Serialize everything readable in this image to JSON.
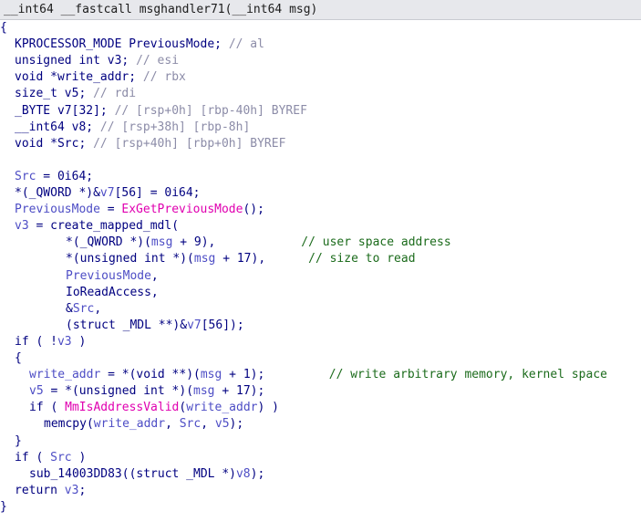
{
  "signature": "__int64 __fastcall msghandler71(__int64 msg)",
  "lines": [
    {
      "indent": 0,
      "parts": [
        {
          "t": "{",
          "k": "brace"
        }
      ]
    },
    {
      "indent": 2,
      "parts": [
        {
          "t": "KPROCESSOR_MODE PreviousMode; ",
          "k": "normal"
        },
        {
          "t": "// al",
          "k": "comment"
        }
      ]
    },
    {
      "indent": 2,
      "parts": [
        {
          "t": "unsigned int v3; ",
          "k": "normal"
        },
        {
          "t": "// esi",
          "k": "comment"
        }
      ]
    },
    {
      "indent": 2,
      "parts": [
        {
          "t": "void *write_addr; ",
          "k": "normal"
        },
        {
          "t": "// rbx",
          "k": "comment"
        }
      ]
    },
    {
      "indent": 2,
      "parts": [
        {
          "t": "size_t v5; ",
          "k": "normal"
        },
        {
          "t": "// rdi",
          "k": "comment"
        }
      ]
    },
    {
      "indent": 2,
      "parts": [
        {
          "t": "_BYTE v7[32]; ",
          "k": "normal"
        },
        {
          "t": "// [rsp+0h] [rbp-40h] BYREF",
          "k": "comment"
        }
      ]
    },
    {
      "indent": 2,
      "parts": [
        {
          "t": "__int64 v8; ",
          "k": "normal"
        },
        {
          "t": "// [rsp+38h] [rbp-8h]",
          "k": "comment"
        }
      ]
    },
    {
      "indent": 2,
      "parts": [
        {
          "t": "void *Src; ",
          "k": "normal"
        },
        {
          "t": "// [rsp+40h] [rbp+0h] BYREF",
          "k": "comment"
        }
      ]
    },
    {
      "indent": 0,
      "parts": []
    },
    {
      "indent": 2,
      "parts": [
        {
          "t": "Src",
          "k": "var"
        },
        {
          "t": " = 0i64;",
          "k": "normal"
        }
      ]
    },
    {
      "indent": 2,
      "parts": [
        {
          "t": "*(_QWORD *)&",
          "k": "normal"
        },
        {
          "t": "v7",
          "k": "var"
        },
        {
          "t": "[56] = 0i64;",
          "k": "normal"
        }
      ]
    },
    {
      "indent": 2,
      "parts": [
        {
          "t": "PreviousMode",
          "k": "var"
        },
        {
          "t": " = ",
          "k": "normal"
        },
        {
          "t": "ExGetPreviousMode",
          "k": "api"
        },
        {
          "t": "();",
          "k": "normal"
        }
      ]
    },
    {
      "indent": 2,
      "parts": [
        {
          "t": "v3",
          "k": "var"
        },
        {
          "t": " = create_mapped_mdl(",
          "k": "normal"
        }
      ]
    },
    {
      "indent": 9,
      "parts": [
        {
          "t": "*(_QWORD *)(",
          "k": "normal"
        },
        {
          "t": "msg",
          "k": "var"
        },
        {
          "t": " + 9),            ",
          "k": "normal"
        },
        {
          "t": "// user space address",
          "k": "commentcode"
        }
      ]
    },
    {
      "indent": 9,
      "parts": [
        {
          "t": "*(unsigned int *)(",
          "k": "normal"
        },
        {
          "t": "msg",
          "k": "var"
        },
        {
          "t": " + 17),      ",
          "k": "normal"
        },
        {
          "t": "// size to read",
          "k": "commentcode"
        }
      ]
    },
    {
      "indent": 9,
      "parts": [
        {
          "t": "PreviousMode",
          "k": "var"
        },
        {
          "t": ",",
          "k": "normal"
        }
      ]
    },
    {
      "indent": 9,
      "parts": [
        {
          "t": "IoReadAccess,",
          "k": "normal"
        }
      ]
    },
    {
      "indent": 9,
      "parts": [
        {
          "t": "&",
          "k": "normal"
        },
        {
          "t": "Src",
          "k": "var"
        },
        {
          "t": ",",
          "k": "normal"
        }
      ]
    },
    {
      "indent": 9,
      "parts": [
        {
          "t": "(struct _MDL **)&",
          "k": "normal"
        },
        {
          "t": "v7",
          "k": "var"
        },
        {
          "t": "[56]);",
          "k": "normal"
        }
      ]
    },
    {
      "indent": 2,
      "parts": [
        {
          "t": "if ( !",
          "k": "normal"
        },
        {
          "t": "v3",
          "k": "var"
        },
        {
          "t": " )",
          "k": "normal"
        }
      ]
    },
    {
      "indent": 2,
      "parts": [
        {
          "t": "{",
          "k": "brace"
        }
      ]
    },
    {
      "indent": 4,
      "parts": [
        {
          "t": "write_addr",
          "k": "var"
        },
        {
          "t": " = *(void **)(",
          "k": "normal"
        },
        {
          "t": "msg",
          "k": "var"
        },
        {
          "t": " + 1);         ",
          "k": "normal"
        },
        {
          "t": "// write arbitrary memory, kernel space",
          "k": "commentcode"
        }
      ]
    },
    {
      "indent": 4,
      "parts": [
        {
          "t": "v5",
          "k": "var"
        },
        {
          "t": " = *(unsigned int *)(",
          "k": "normal"
        },
        {
          "t": "msg",
          "k": "var"
        },
        {
          "t": " + 17);",
          "k": "normal"
        }
      ]
    },
    {
      "indent": 4,
      "parts": [
        {
          "t": "if ( ",
          "k": "normal"
        },
        {
          "t": "MmIsAddressValid",
          "k": "api"
        },
        {
          "t": "(",
          "k": "normal"
        },
        {
          "t": "write_addr",
          "k": "var"
        },
        {
          "t": ") )",
          "k": "normal"
        }
      ]
    },
    {
      "indent": 6,
      "parts": [
        {
          "t": "memcpy(",
          "k": "normal"
        },
        {
          "t": "write_addr",
          "k": "var"
        },
        {
          "t": ", ",
          "k": "normal"
        },
        {
          "t": "Src",
          "k": "var"
        },
        {
          "t": ", ",
          "k": "normal"
        },
        {
          "t": "v5",
          "k": "var"
        },
        {
          "t": ");",
          "k": "normal"
        }
      ]
    },
    {
      "indent": 2,
      "parts": [
        {
          "t": "}",
          "k": "brace"
        }
      ]
    },
    {
      "indent": 2,
      "parts": [
        {
          "t": "if ( ",
          "k": "normal"
        },
        {
          "t": "Src",
          "k": "var"
        },
        {
          "t": " )",
          "k": "normal"
        }
      ]
    },
    {
      "indent": 4,
      "parts": [
        {
          "t": "sub_14003DD83((struct _MDL *)",
          "k": "normal"
        },
        {
          "t": "v8",
          "k": "var"
        },
        {
          "t": ");",
          "k": "normal"
        }
      ]
    },
    {
      "indent": 2,
      "parts": [
        {
          "t": "return ",
          "k": "normal"
        },
        {
          "t": "v3",
          "k": "var"
        },
        {
          "t": ";",
          "k": "normal"
        }
      ]
    },
    {
      "indent": 0,
      "parts": [
        {
          "t": "}",
          "k": "brace"
        }
      ]
    }
  ],
  "colors": {
    "normal": "#000080",
    "variable": "#4d4dc5",
    "api_call": "#e000b0",
    "comment": "#8c8ca8",
    "annotation_comment": "#1b6b1b",
    "header_bg": "#e7e8ec"
  }
}
